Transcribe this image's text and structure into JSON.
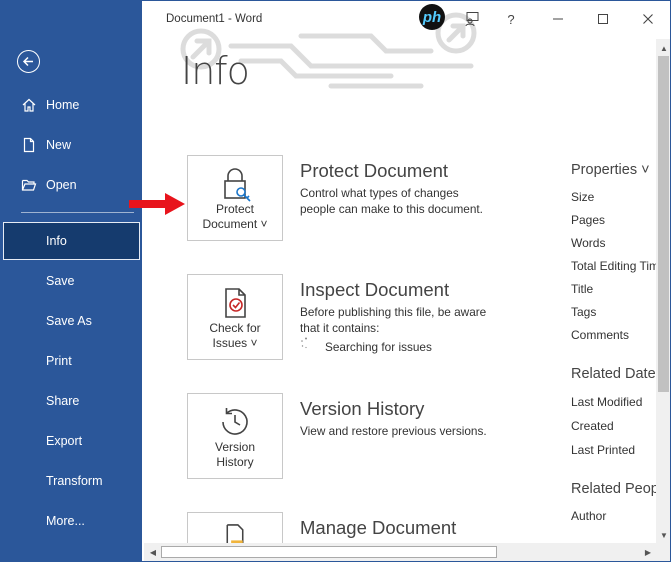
{
  "window": {
    "title": "Document1 - Word",
    "controls": {
      "help": "?"
    }
  },
  "sidebar": {
    "items": [
      {
        "label": "Home",
        "icon": "home-icon"
      },
      {
        "label": "New",
        "icon": "new-document-icon"
      },
      {
        "label": "Open",
        "icon": "folder-open-icon"
      },
      {
        "label": "Info",
        "active": true
      },
      {
        "label": "Save"
      },
      {
        "label": "Save As"
      },
      {
        "label": "Print"
      },
      {
        "label": "Share"
      },
      {
        "label": "Export"
      },
      {
        "label": "Transform"
      },
      {
        "label": "More..."
      }
    ]
  },
  "page": {
    "title": "Info"
  },
  "cards": [
    {
      "button_line1": "Protect",
      "button_line2": "Document ˅",
      "title": "Protect Document",
      "desc_line1": "Control what types of changes",
      "desc_line2": "people can make to this document.",
      "icon": "lock-key-icon"
    },
    {
      "button_line1": "Check for",
      "button_line2": "Issues ˅",
      "title": "Inspect Document",
      "desc_line1": "Before publishing this file, be aware",
      "desc_line2": "that it contains:",
      "status": "Searching for issues",
      "icon": "document-check-icon"
    },
    {
      "button_line1": "Version",
      "button_line2": "History",
      "title": "Version History",
      "desc_line1": "View and restore previous versions.",
      "icon": "clock-history-icon"
    },
    {
      "title": "Manage Document",
      "icon": "document-folder-icon"
    }
  ],
  "properties": {
    "heading": "Properties ˅",
    "items": [
      "Size",
      "Pages",
      "Words",
      "Total Editing Tim",
      "Title",
      "Tags",
      "Comments"
    ],
    "related_dates_heading": "Related Date",
    "related_dates": [
      "Last Modified",
      "Created",
      "Last Printed"
    ],
    "related_people_heading": "Related Peop",
    "related_people": [
      "Author"
    ]
  },
  "colors": {
    "sidebar_bg": "#2b579a",
    "active_item": "#153b6e",
    "arrow": "#e8141c"
  }
}
